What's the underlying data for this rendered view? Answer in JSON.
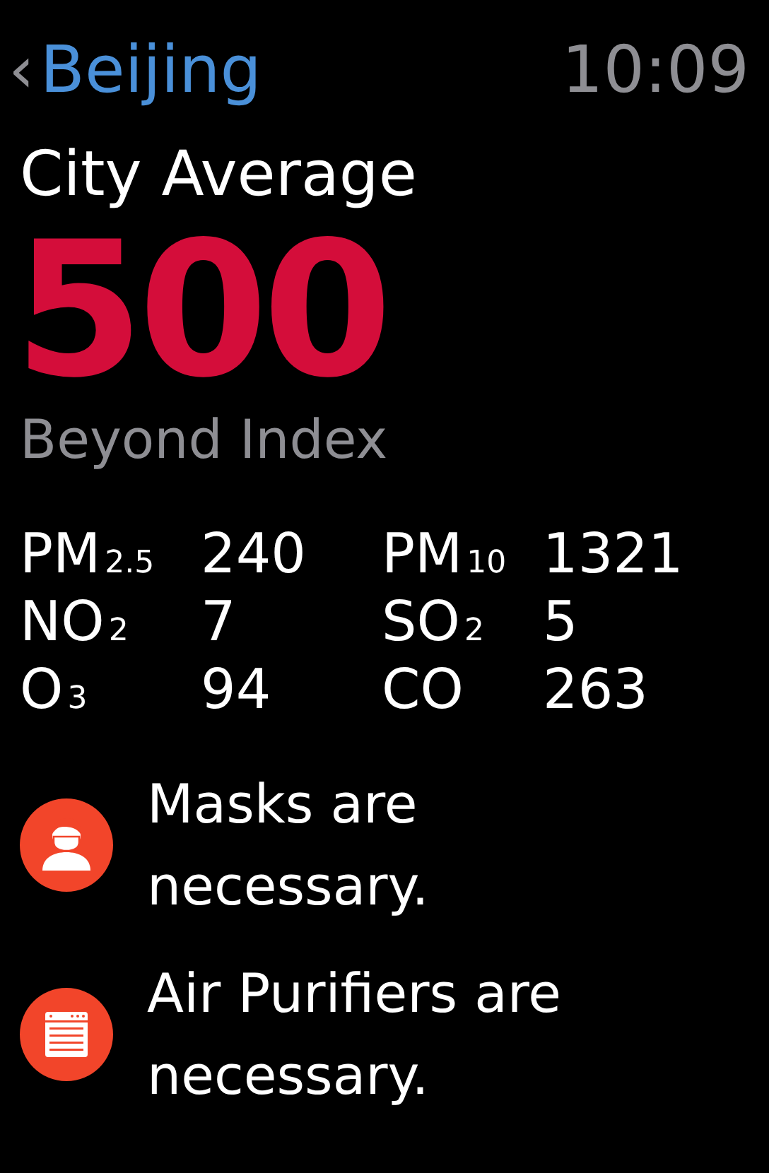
{
  "header": {
    "back": "‹",
    "title": "Beijing",
    "time": "10:09"
  },
  "summary": {
    "label": "City Average",
    "value": "500",
    "level_text": "Beyond Index"
  },
  "pollutants": [
    {
      "name": "PM$_{2.5}$",
      "value": "240"
    },
    {
      "name": "PM$_{10}$",
      "value": "1321"
    },
    {
      "name": "NO$_{2}$",
      "value": "7"
    },
    {
      "name": "SO$_{2}$",
      "value": "5"
    },
    {
      "name": "O$_{3}$",
      "value": "94"
    },
    {
      "name": "CO",
      "value": "263"
    }
  ],
  "advice": [
    {
      "kind": "mask",
      "text": "Masks are necessary."
    },
    {
      "kind": "purifier",
      "text": "Air Purifiers are necessary."
    }
  ]
}
